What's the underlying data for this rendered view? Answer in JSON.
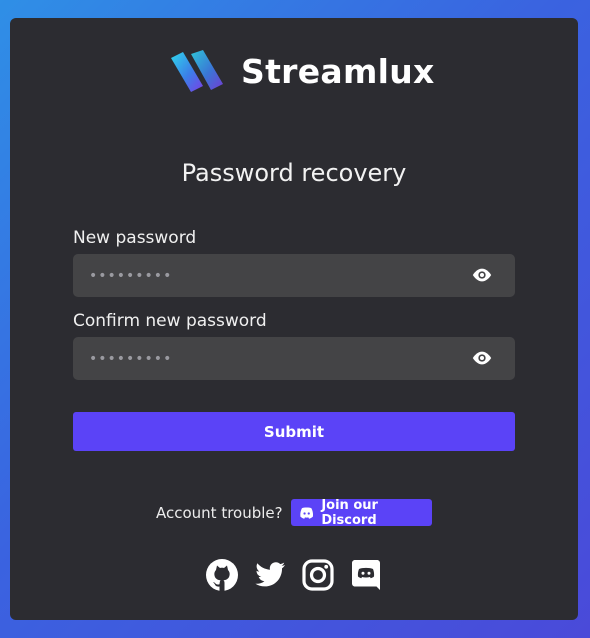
{
  "brand": {
    "name": "Streamlux",
    "logo_icon": "streamlux-logo-icon"
  },
  "page": {
    "title": "Password recovery"
  },
  "form": {
    "new_password": {
      "label": "New password",
      "value": "•••••••••",
      "toggle_icon": "eye-icon"
    },
    "confirm_password": {
      "label": "Confirm new password",
      "value": "•••••••••",
      "toggle_icon": "eye-icon"
    },
    "submit_label": "Submit"
  },
  "footer": {
    "trouble_text": "Account trouble?",
    "discord_button_label": "Join our Discord",
    "socials": [
      "github-icon",
      "twitter-icon",
      "instagram-icon",
      "discord-icon"
    ]
  },
  "colors": {
    "card": "#2c2c31",
    "field": "#444446",
    "accent": "#5b43f7",
    "gradient_start": "#2f8fe6",
    "gradient_end": "#4a4ad9"
  }
}
